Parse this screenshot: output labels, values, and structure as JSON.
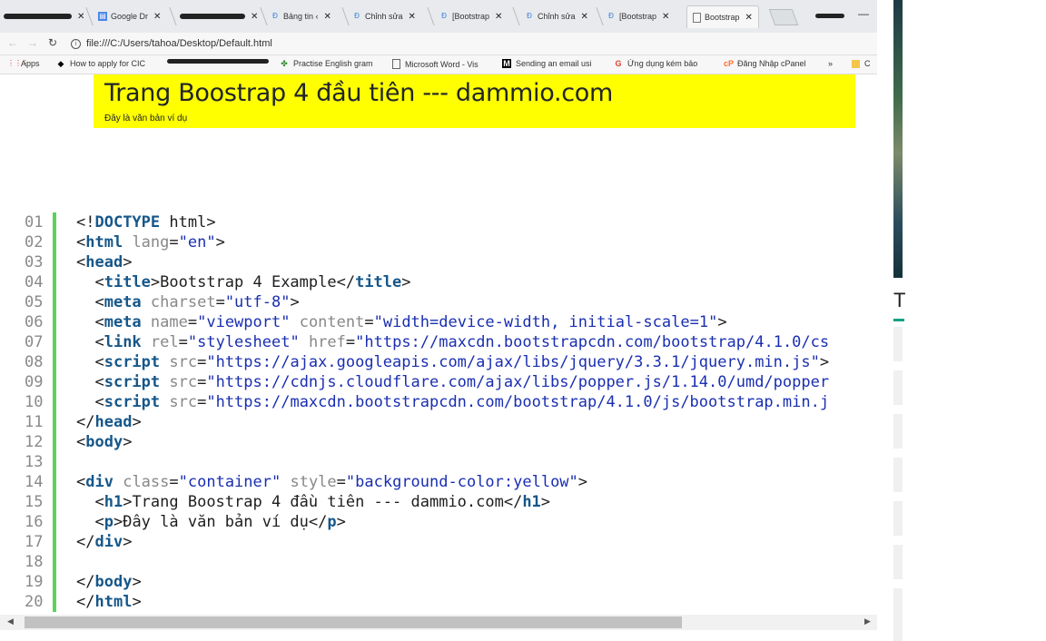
{
  "tabs": [
    {
      "label": "",
      "icon": "scribble-icon"
    },
    {
      "label": "Google Dr",
      "icon": "google-docs-icon"
    },
    {
      "label": "",
      "icon": "scribble-icon"
    },
    {
      "label": "Bảng tin ‹",
      "icon": "dammio-icon"
    },
    {
      "label": "Chỉnh sửa",
      "icon": "dammio-icon"
    },
    {
      "label": "[Bootstrap",
      "icon": "dammio-icon"
    },
    {
      "label": "Chỉnh sửa",
      "icon": "dammio-icon"
    },
    {
      "label": "[Bootstrap",
      "icon": "dammio-icon"
    },
    {
      "label": "Bootstrap",
      "icon": "document-icon",
      "active": true
    }
  ],
  "toolbar": {
    "url": "file:///C:/Users/tahoa/Desktop/Default.html"
  },
  "bookmarks": [
    {
      "label": "Apps",
      "icon": "apps-grid-icon"
    },
    {
      "label": "How to apply for CIC",
      "icon": "hat-icon"
    },
    {
      "label": "",
      "icon": "scribble-icon"
    },
    {
      "label": "Practise English gram",
      "icon": "clover-icon"
    },
    {
      "label": "Microsoft Word - Vis",
      "icon": "document-icon"
    },
    {
      "label": "Sending an email usi",
      "icon": "medium-icon"
    },
    {
      "label": "Ứng dụng kém bảo",
      "icon": "google-icon"
    },
    {
      "label": "Đăng Nhập cPanel",
      "icon": "cpanel-icon"
    },
    {
      "label": "»",
      "icon": "overflow-icon"
    },
    {
      "label": "C",
      "icon": "folder-icon"
    }
  ],
  "page": {
    "heading": "Trang Boostrap 4 đầu tiên --- dammio.com",
    "paragraph": "Đây là văn bản ví dụ"
  },
  "code_lines": [
    {
      "n": "01",
      "tokens": [
        [
          "pn",
          "<!"
        ],
        [
          "tg",
          "DOCTYPE"
        ],
        [
          "pn",
          " html>"
        ]
      ]
    },
    {
      "n": "02",
      "tokens": [
        [
          "pn",
          "<"
        ],
        [
          "tg",
          "html"
        ],
        [
          "at",
          " lang"
        ],
        [
          "pn",
          "="
        ],
        [
          "sv",
          "\"en\""
        ],
        [
          "pn",
          ">"
        ]
      ]
    },
    {
      "n": "03",
      "tokens": [
        [
          "pn",
          "<"
        ],
        [
          "tg",
          "head"
        ],
        [
          "pn",
          ">"
        ]
      ]
    },
    {
      "n": "04",
      "tokens": [
        [
          "pn",
          "  <"
        ],
        [
          "tg",
          "title"
        ],
        [
          "pn",
          ">Bootstrap 4 Example</"
        ],
        [
          "tg",
          "title"
        ],
        [
          "pn",
          ">"
        ]
      ]
    },
    {
      "n": "05",
      "tokens": [
        [
          "pn",
          "  <"
        ],
        [
          "tg",
          "meta"
        ],
        [
          "at",
          " charset"
        ],
        [
          "pn",
          "="
        ],
        [
          "sv",
          "\"utf-8\""
        ],
        [
          "pn",
          ">"
        ]
      ]
    },
    {
      "n": "06",
      "tokens": [
        [
          "pn",
          "  <"
        ],
        [
          "tg",
          "meta"
        ],
        [
          "at",
          " name"
        ],
        [
          "pn",
          "="
        ],
        [
          "sv",
          "\"viewport\""
        ],
        [
          "at",
          " content"
        ],
        [
          "pn",
          "="
        ],
        [
          "sv",
          "\"width=device-width, initial-scale=1\""
        ],
        [
          "pn",
          ">"
        ]
      ]
    },
    {
      "n": "07",
      "tokens": [
        [
          "pn",
          "  <"
        ],
        [
          "tg",
          "link"
        ],
        [
          "at",
          " rel"
        ],
        [
          "pn",
          "="
        ],
        [
          "sv",
          "\"stylesheet\""
        ],
        [
          "at",
          " href"
        ],
        [
          "pn",
          "="
        ],
        [
          "sv",
          "\"https://maxcdn.bootstrapcdn.com/bootstrap/4.1.0/cs"
        ]
      ]
    },
    {
      "n": "08",
      "tokens": [
        [
          "pn",
          "  <"
        ],
        [
          "tg",
          "script"
        ],
        [
          "at",
          " src"
        ],
        [
          "pn",
          "="
        ],
        [
          "sv",
          "\"https://ajax.googleapis.com/ajax/libs/jquery/3.3.1/jquery.min.js\""
        ],
        [
          "pn",
          ">"
        ]
      ]
    },
    {
      "n": "09",
      "tokens": [
        [
          "pn",
          "  <"
        ],
        [
          "tg",
          "script"
        ],
        [
          "at",
          " src"
        ],
        [
          "pn",
          "="
        ],
        [
          "sv",
          "\"https://cdnjs.cloudflare.com/ajax/libs/popper.js/1.14.0/umd/popper"
        ]
      ]
    },
    {
      "n": "10",
      "tokens": [
        [
          "pn",
          "  <"
        ],
        [
          "tg",
          "script"
        ],
        [
          "at",
          " src"
        ],
        [
          "pn",
          "="
        ],
        [
          "sv",
          "\"https://maxcdn.bootstrapcdn.com/bootstrap/4.1.0/js/bootstrap.min.j"
        ]
      ]
    },
    {
      "n": "11",
      "tokens": [
        [
          "pn",
          "</"
        ],
        [
          "tg",
          "head"
        ],
        [
          "pn",
          ">"
        ]
      ]
    },
    {
      "n": "12",
      "tokens": [
        [
          "pn",
          "<"
        ],
        [
          "tg",
          "body"
        ],
        [
          "pn",
          ">"
        ]
      ]
    },
    {
      "n": "13",
      "tokens": []
    },
    {
      "n": "14",
      "tokens": [
        [
          "pn",
          "<"
        ],
        [
          "tg",
          "div"
        ],
        [
          "at",
          " class"
        ],
        [
          "pn",
          "="
        ],
        [
          "sv",
          "\"container\""
        ],
        [
          "at",
          " style"
        ],
        [
          "pn",
          "="
        ],
        [
          "sv",
          "\"background-color:yellow\""
        ],
        [
          "pn",
          ">"
        ]
      ]
    },
    {
      "n": "15",
      "tokens": [
        [
          "pn",
          "  <"
        ],
        [
          "tg",
          "h1"
        ],
        [
          "pn",
          ">Trang Boostrap 4 đầu tiên --- dammio.com</"
        ],
        [
          "tg",
          "h1"
        ],
        [
          "pn",
          ">"
        ]
      ]
    },
    {
      "n": "16",
      "tokens": [
        [
          "pn",
          "  <"
        ],
        [
          "tg",
          "p"
        ],
        [
          "pn",
          ">Đây là văn bản ví dụ</"
        ],
        [
          "tg",
          "p"
        ],
        [
          "pn",
          ">"
        ]
      ]
    },
    {
      "n": "17",
      "tokens": [
        [
          "pn",
          "</"
        ],
        [
          "tg",
          "div"
        ],
        [
          "pn",
          ">"
        ]
      ]
    },
    {
      "n": "18",
      "tokens": []
    },
    {
      "n": "19",
      "tokens": [
        [
          "pn",
          "</"
        ],
        [
          "tg",
          "body"
        ],
        [
          "pn",
          ">"
        ]
      ]
    },
    {
      "n": "20",
      "tokens": [
        [
          "pn",
          "</"
        ],
        [
          "tg",
          "html"
        ],
        [
          "pn",
          ">"
        ]
      ]
    }
  ],
  "side": {
    "letter": "T"
  },
  "colors": {
    "highlight": "#ffff00",
    "gutter_accent": "#5bd35b",
    "tag": "#16578a",
    "string": "#1a2fb0"
  }
}
